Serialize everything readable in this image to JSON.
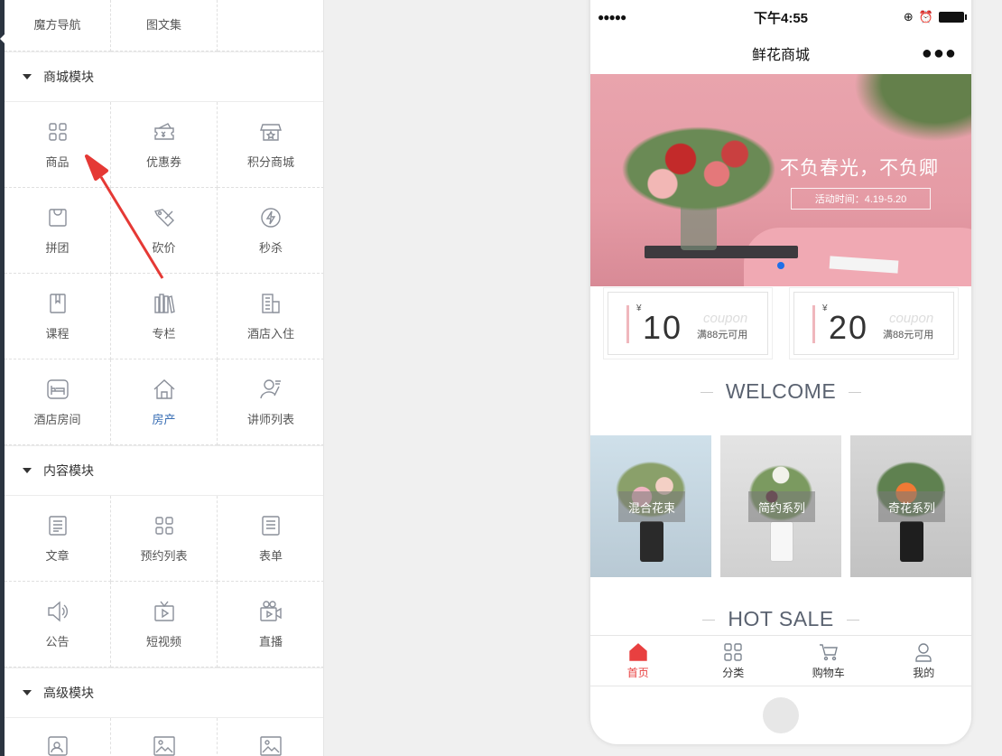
{
  "panel": {
    "top_row": [
      "魔方导航",
      "图文集"
    ],
    "sections": [
      {
        "title": "商城模块",
        "items": [
          {
            "label": "商品",
            "icon": "grid-icon"
          },
          {
            "label": "优惠券",
            "icon": "coupon-icon"
          },
          {
            "label": "积分商城",
            "icon": "store-icon"
          },
          {
            "label": "拼团",
            "icon": "bag-icon"
          },
          {
            "label": "砍价",
            "icon": "tag-icon"
          },
          {
            "label": "秒杀",
            "icon": "lightning-icon"
          },
          {
            "label": "课程",
            "icon": "book-icon"
          },
          {
            "label": "专栏",
            "icon": "books-icon"
          },
          {
            "label": "酒店入住",
            "icon": "building-icon"
          },
          {
            "label": "酒店房间",
            "icon": "bed-icon"
          },
          {
            "label": "房产",
            "icon": "house-icon"
          },
          {
            "label": "讲师列表",
            "icon": "teacher-icon"
          }
        ]
      },
      {
        "title": "内容模块",
        "items": [
          {
            "label": "文章",
            "icon": "article-icon"
          },
          {
            "label": "预约列表",
            "icon": "grid-icon"
          },
          {
            "label": "表单",
            "icon": "form-icon"
          },
          {
            "label": "公告",
            "icon": "speaker-icon"
          },
          {
            "label": "短视频",
            "icon": "tv-icon"
          },
          {
            "label": "直播",
            "icon": "camera-icon"
          }
        ]
      },
      {
        "title": "高级模块",
        "items": [
          {
            "label": "",
            "icon": "profile-card-icon"
          },
          {
            "label": "",
            "icon": "image-icon"
          },
          {
            "label": "",
            "icon": "image-icon"
          }
        ]
      }
    ]
  },
  "phone": {
    "status_time": "下午4:55",
    "nav_title": "鲜花商城",
    "nav_more": "●●●",
    "banner_title": "不负春光，不负卿",
    "banner_sub": "活动时间：4.19-5.20",
    "coupons": [
      {
        "yen": "¥",
        "amount": "10",
        "word": "coupon",
        "condition": "满88元可用"
      },
      {
        "yen": "¥",
        "amount": "20",
        "word": "coupon",
        "condition": "满88元可用"
      }
    ],
    "welcome": "WELCOME",
    "categories": [
      "混合花束",
      "简约系列",
      "奇花系列"
    ],
    "hot_sale": "HOT SALE",
    "tabs": [
      {
        "label": "首页",
        "icon": "home-icon",
        "active": true
      },
      {
        "label": "分类",
        "icon": "category-icon",
        "active": false
      },
      {
        "label": "购物车",
        "icon": "cart-icon",
        "active": false
      },
      {
        "label": "我的",
        "icon": "user-icon",
        "active": false
      }
    ]
  },
  "colors": {
    "accent_red": "#e84040",
    "active_blue_label": "#3a6fb5",
    "banner_pink": "#e9a4ad",
    "rail_dark": "#2b3440"
  }
}
